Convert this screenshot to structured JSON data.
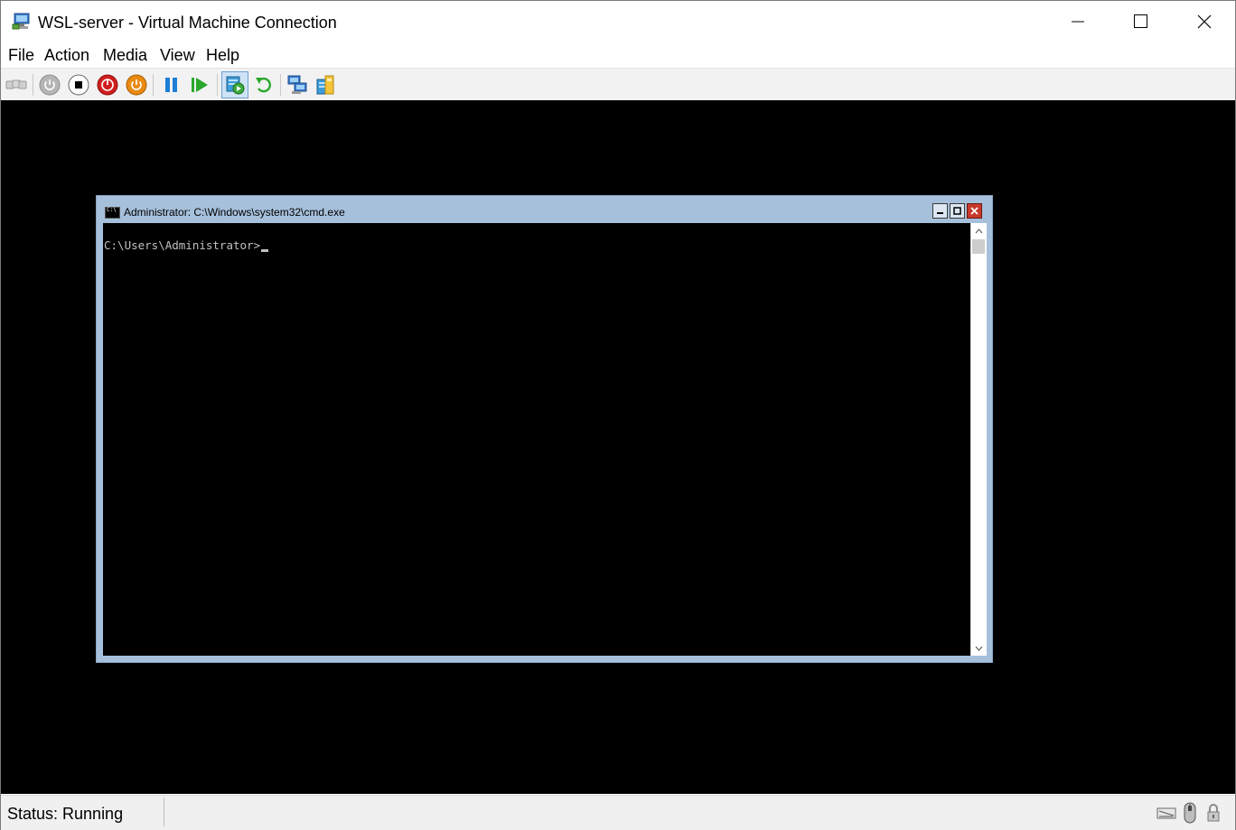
{
  "window": {
    "title": "WSL-server - Virtual Machine Connection"
  },
  "menu": [
    "File",
    "Action",
    "Media",
    "View",
    "Help"
  ],
  "toolbar": {
    "buttons": [
      "ctrl-alt-del",
      "start",
      "turn-off",
      "shut-down",
      "save",
      "pause",
      "reset",
      "checkpoint",
      "revert",
      "enhanced-session",
      "share"
    ]
  },
  "guest": {
    "cmd_window": {
      "title": "Administrator: C:\\Windows\\system32\\cmd.exe",
      "prompt": "C:\\Users\\Administrator>"
    }
  },
  "status": {
    "text": "Status: Running",
    "icons": [
      "keyboard-icon",
      "mouse-icon",
      "lock-icon"
    ]
  },
  "colors": {
    "cmd_frame": "#a6c0db",
    "cmd_close": "#c7392b",
    "screen_bg": "#000000"
  }
}
